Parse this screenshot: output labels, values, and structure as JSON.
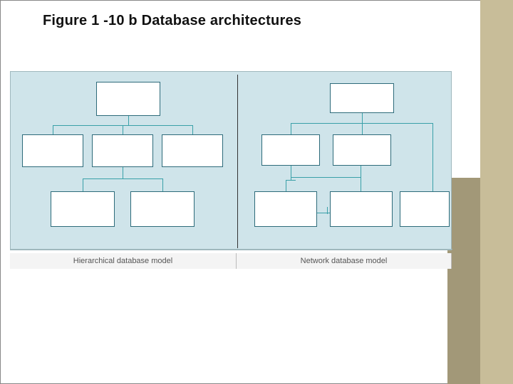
{
  "figure_label": "Figure 1 -10 b  Database architectures",
  "captions": {
    "left": "Hierarchical database model",
    "right": "Network database model"
  },
  "diagram": {
    "hierarchical": {
      "description": "One root node branches to three children; middle child branches to two grandchildren (tree / strict hierarchy)",
      "root": "",
      "children": [
        "",
        "",
        ""
      ],
      "grandchildren_of_middle": [
        "",
        ""
      ]
    },
    "network": {
      "description": "One top node connects to two middle nodes; three bottom nodes have multiple parents (many-to-many links)",
      "root": "",
      "middle_level": [
        "",
        ""
      ],
      "bottom_level": [
        "",
        "",
        ""
      ]
    }
  },
  "colors": {
    "panel_bg": "#cfe4ea",
    "box_border": "#2d6b7a",
    "connector": "#39a0a8",
    "side_stripe_light": "#c8bd99",
    "side_stripe_dark": "#a29878"
  }
}
